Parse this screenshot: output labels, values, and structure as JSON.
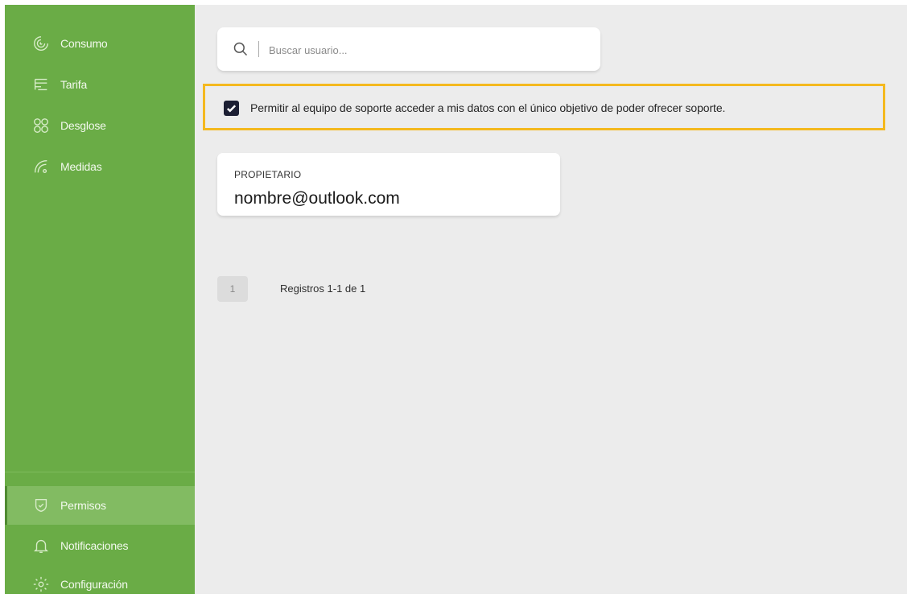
{
  "sidebar": {
    "top_items": [
      {
        "label": "Consumo",
        "icon": "spiral-gauge-icon"
      },
      {
        "label": "Tarifa",
        "icon": "tariff-lines-icon"
      },
      {
        "label": "Desglose",
        "icon": "breakdown-circles-icon"
      },
      {
        "label": "Medidas",
        "icon": "meter-signal-icon"
      }
    ],
    "bottom_items": [
      {
        "label": "Permisos",
        "icon": "shield-check-icon",
        "active": true
      },
      {
        "label": "Notificaciones",
        "icon": "bell-icon"
      },
      {
        "label": "Configuración",
        "icon": "gear-icon"
      }
    ]
  },
  "search": {
    "placeholder": "Buscar usuario...",
    "value": ""
  },
  "consent": {
    "checked": true,
    "text": "Permitir al equipo de soporte acceder a mis datos con el único objetivo de poder ofrecer soporte."
  },
  "owner": {
    "label": "PROPIETARIO",
    "email": "nombre@outlook.com"
  },
  "pagination": {
    "current_page": "1",
    "records_text": "Registros 1-1 de 1"
  },
  "colors": {
    "sidebar": "#6aac46",
    "highlight_frame": "#f4b91f",
    "checkbox": "#1c1f33",
    "content_bg": "#ececec"
  }
}
